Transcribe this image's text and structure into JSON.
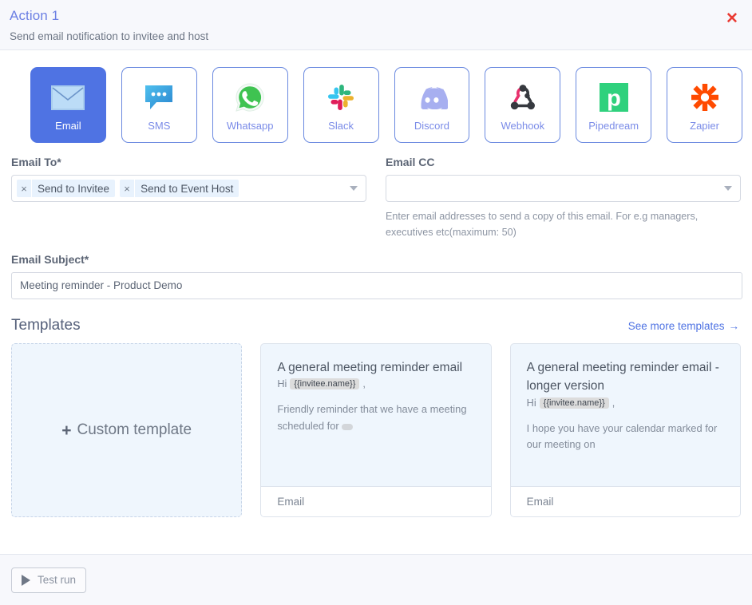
{
  "header": {
    "title": "Action 1",
    "subtitle": "Send email notification to invitee and host",
    "close_label": "✕"
  },
  "channels": [
    {
      "label": "Email",
      "icon": "email-icon",
      "selected": true
    },
    {
      "label": "SMS",
      "icon": "sms-icon",
      "selected": false
    },
    {
      "label": "Whatsapp",
      "icon": "whatsapp-icon",
      "selected": false
    },
    {
      "label": "Slack",
      "icon": "slack-icon",
      "selected": false
    },
    {
      "label": "Discord",
      "icon": "discord-icon",
      "selected": false
    },
    {
      "label": "Webhook",
      "icon": "webhook-icon",
      "selected": false
    },
    {
      "label": "Pipedream",
      "icon": "pipedream-icon",
      "selected": false
    },
    {
      "label": "Zapier",
      "icon": "zapier-icon",
      "selected": false
    }
  ],
  "email_to": {
    "label": "Email To*",
    "chips": [
      {
        "label": "Send to Invitee",
        "remove": "×"
      },
      {
        "label": "Send to Event Host",
        "remove": "×"
      }
    ]
  },
  "email_cc": {
    "label": "Email CC",
    "value": "",
    "placeholder": "",
    "helper": "Enter email addresses to send a copy of this email. For e.g managers, executives etc(maximum: 50)"
  },
  "email_subject": {
    "label": "Email Subject*",
    "value": "Meeting reminder - Product Demo",
    "placeholder": "Email subject"
  },
  "templates": {
    "title": "Templates",
    "see_more": "See more templates",
    "see_more_arrow": "→",
    "custom": {
      "plus": "+",
      "label": "Custom template"
    },
    "cards": [
      {
        "title": "A general meeting reminder email",
        "greeting_prefix": "Hi",
        "token": "{{invitee.name}}",
        "greeting_suffix": ",",
        "text": "Friendly reminder that we have a meeting scheduled for",
        "footer": "Email"
      },
      {
        "title": "A general meeting reminder email - longer version",
        "greeting_prefix": "Hi",
        "token": "{{invitee.name}}",
        "greeting_suffix": ",",
        "text": "I hope you have your calendar marked for our meeting on",
        "footer": "Email"
      }
    ]
  },
  "footer": {
    "test_run": "Test run"
  },
  "colors": {
    "accent": "#4f73e3",
    "link": "#4f73e3",
    "close": "#ea3b33",
    "chip_bg": "#e8f2fd",
    "card_bg": "#eff6fd",
    "header_bg": "#f7f8fc"
  }
}
